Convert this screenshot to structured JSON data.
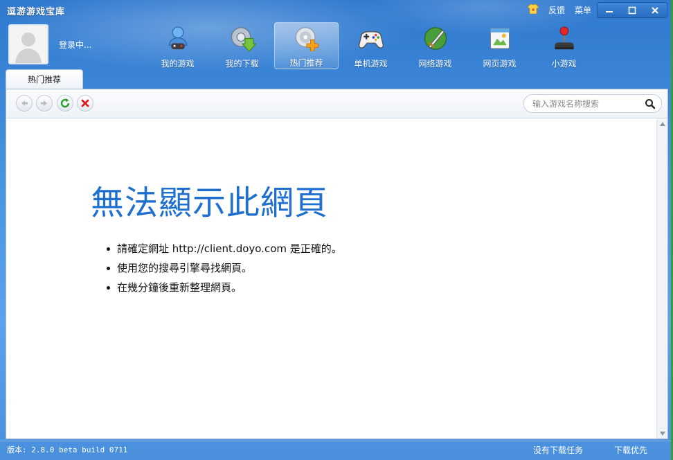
{
  "window": {
    "title": "逗游游戏宝库"
  },
  "top_links": {
    "feedback": "反馈",
    "menu": "菜单"
  },
  "user": {
    "status": "登录中..."
  },
  "nav": {
    "items": [
      {
        "label": "我的游戏",
        "icon": "gamer-icon"
      },
      {
        "label": "我的下载",
        "icon": "download-icon"
      },
      {
        "label": "热门推荐",
        "icon": "recommend-icon"
      },
      {
        "label": "单机游戏",
        "icon": "gamepad-icon"
      },
      {
        "label": "网络游戏",
        "icon": "sword-icon"
      },
      {
        "label": "网页游戏",
        "icon": "webpage-icon"
      },
      {
        "label": "小游戏",
        "icon": "joystick-icon"
      }
    ],
    "active": "热门推荐"
  },
  "tab": {
    "label": "热门推荐"
  },
  "search": {
    "placeholder": "输入游戏名称搜索",
    "value": ""
  },
  "error_page": {
    "title": "無法顯示此網頁",
    "bullets": [
      "請確定網址 http://client.doyo.com 是正確的。",
      "使用您的搜尋引擎尋找網頁。",
      "在幾分鐘後重新整理網頁。"
    ]
  },
  "statusbar": {
    "version": "版本: 2.8.0 beta build 0711",
    "task": "没有下载任务",
    "priority": "下载优先"
  },
  "colors": {
    "accent": "#2f79cf",
    "error_title": "#1f6fcf"
  }
}
